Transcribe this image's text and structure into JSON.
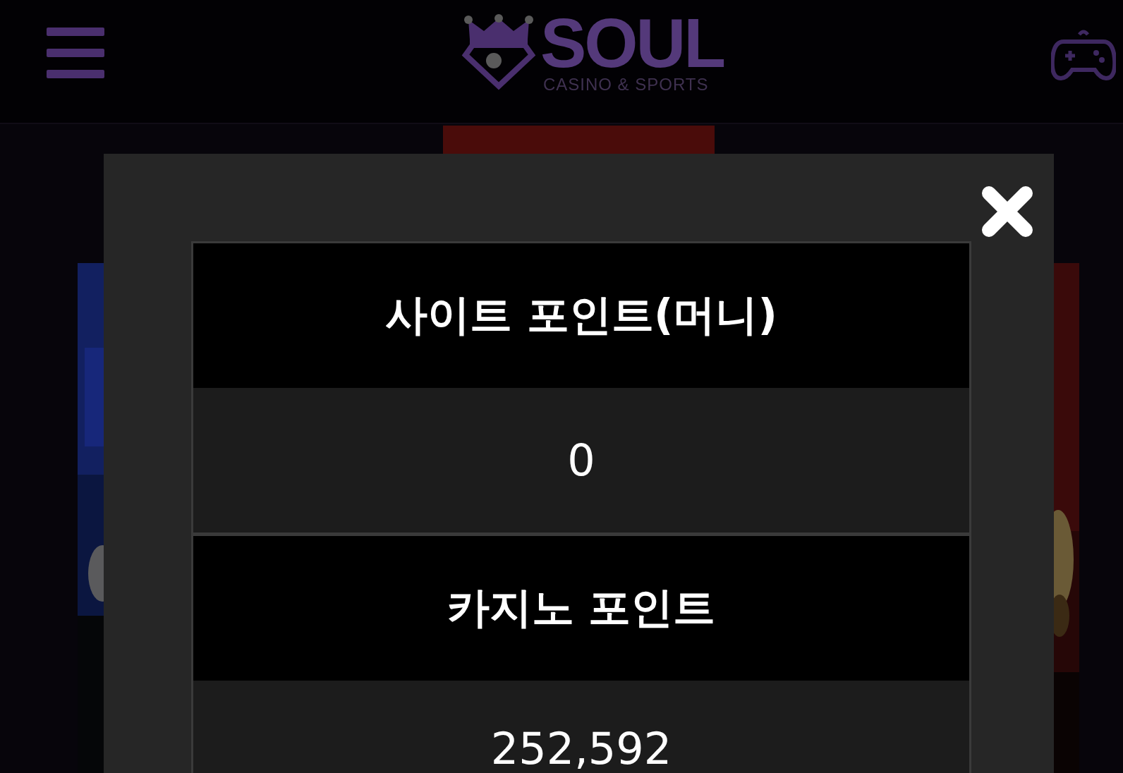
{
  "header": {
    "logo": {
      "name": "SOUL",
      "tagline": "CASINO & SPORTS"
    }
  },
  "modal": {
    "sections": [
      {
        "title": "사이트 포인트(머니)",
        "value": "0"
      },
      {
        "title": "카지노 포인트",
        "value": "252,592"
      }
    ]
  }
}
